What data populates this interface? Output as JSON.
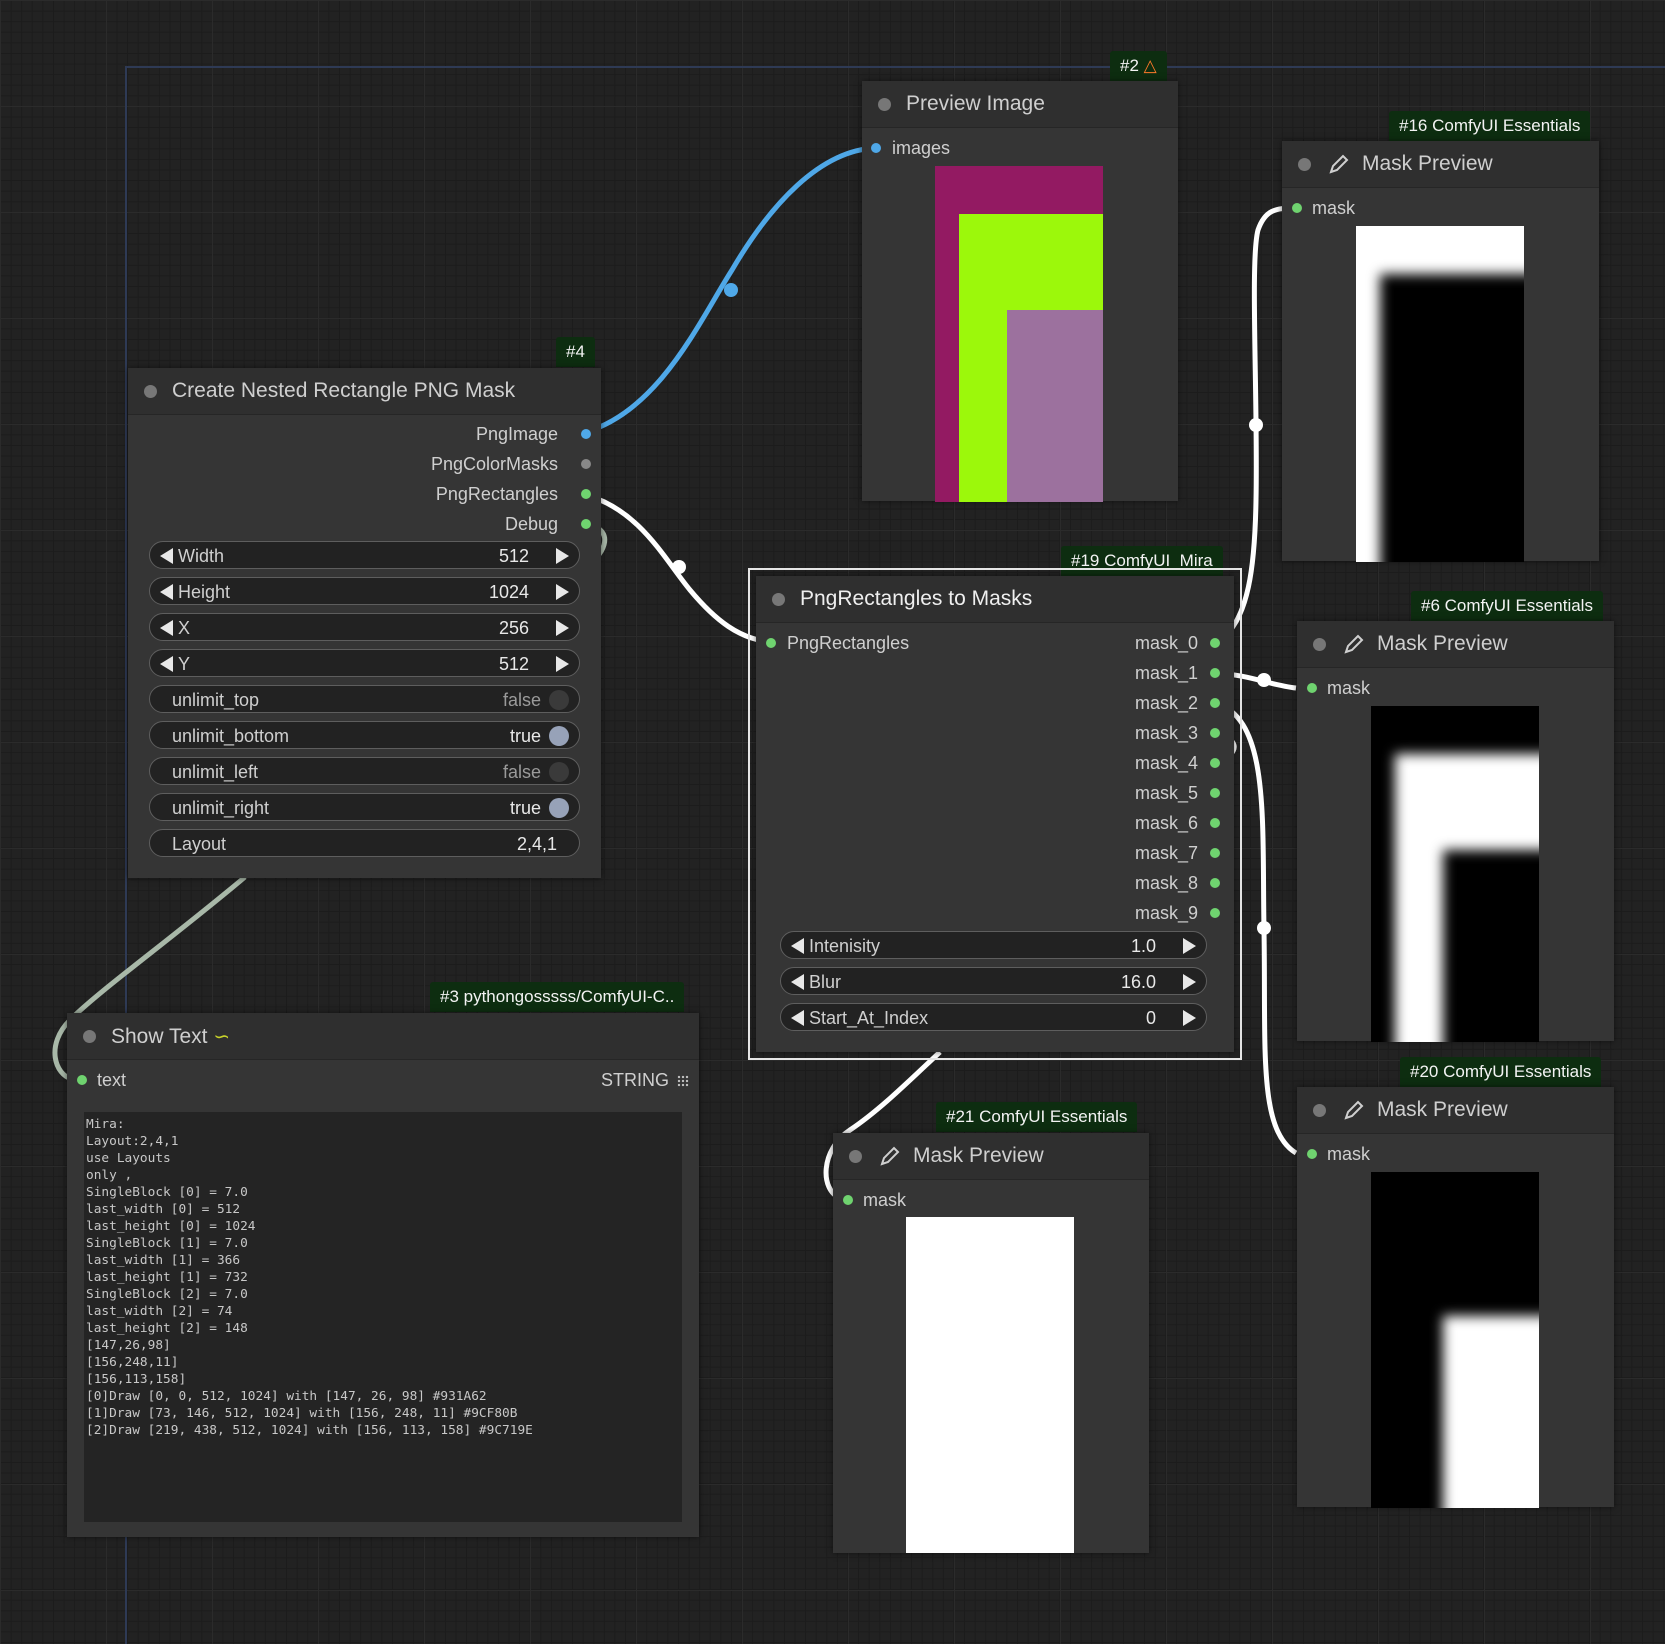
{
  "colors": {
    "rect0": "#931A62",
    "rect1": "#9CF80B",
    "rect2": "#9C719E",
    "badge_bg": "#0d2d10",
    "link_image": "#4fa8e8",
    "link_mask": "#ffffff",
    "link_string": "#a8b8a8"
  },
  "nodes": {
    "preview_image": {
      "badge": "#2",
      "badge_icon": "fox-icon",
      "title": "Preview Image",
      "input": "images"
    },
    "create_mask": {
      "badge": "#4",
      "title": "Create Nested Rectangle PNG Mask",
      "outputs": [
        "PngImage",
        "PngColorMasks",
        "PngRectangles",
        "Debug"
      ],
      "widgets": {
        "width": {
          "label": "Width",
          "value": "512"
        },
        "height": {
          "label": "Height",
          "value": "1024"
        },
        "x": {
          "label": "X",
          "value": "256"
        },
        "y": {
          "label": "Y",
          "value": "512"
        },
        "unlimit_top": {
          "label": "unlimit_top",
          "value": "false"
        },
        "unlimit_bottom": {
          "label": "unlimit_bottom",
          "value": "true"
        },
        "unlimit_left": {
          "label": "unlimit_left",
          "value": "false"
        },
        "unlimit_right": {
          "label": "unlimit_right",
          "value": "true"
        },
        "layout": {
          "label": "Layout",
          "value": "2,4,1"
        }
      }
    },
    "rect_to_masks": {
      "badge": "#19 ComfyUI_Mira",
      "title": "PngRectangles to Masks",
      "input": "PngRectangles",
      "outputs": [
        "mask_0",
        "mask_1",
        "mask_2",
        "mask_3",
        "mask_4",
        "mask_5",
        "mask_6",
        "mask_7",
        "mask_8",
        "mask_9"
      ],
      "widgets": {
        "intensity": {
          "label": "Intenisity",
          "value": "1.0"
        },
        "blur": {
          "label": "Blur",
          "value": "16.0"
        },
        "start_at_index": {
          "label": "Start_At_Index",
          "value": "0"
        }
      }
    },
    "show_text": {
      "badge": "#3 pythongosssss/ComfyUI-C..",
      "title": "Show Text",
      "title_icon": "snake-icon",
      "input": "text",
      "input_type": "STRING",
      "text": "Mira:\nLayout:2,4,1\nuse Layouts\nonly ,\nSingleBlock [0] = 7.0\nlast_width [0] = 512\nlast_height [0] = 1024\nSingleBlock [1] = 7.0\nlast_width [1] = 366\nlast_height [1] = 732\nSingleBlock [2] = 7.0\nlast_width [2] = 74\nlast_height [2] = 148\n[147,26,98]\n[156,248,11]\n[156,113,158]\n[0]Draw [0, 0, 512, 1024] with [147, 26, 98] #931A62\n[1]Draw [73, 146, 512, 1024] with [156, 248, 11] #9CF80B\n[2]Draw [219, 438, 512, 1024] with [156, 113, 158] #9C719E"
    },
    "mask_preview_16": {
      "badge": "#16 ComfyUI Essentials",
      "title": "Mask Preview",
      "input": "mask"
    },
    "mask_preview_6": {
      "badge": "#6 ComfyUI Essentials",
      "title": "Mask Preview",
      "input": "mask"
    },
    "mask_preview_20": {
      "badge": "#20 ComfyUI Essentials",
      "title": "Mask Preview",
      "input": "mask"
    },
    "mask_preview_21": {
      "badge": "#21 ComfyUI Essentials",
      "title": "Mask Preview",
      "input": "mask"
    }
  }
}
